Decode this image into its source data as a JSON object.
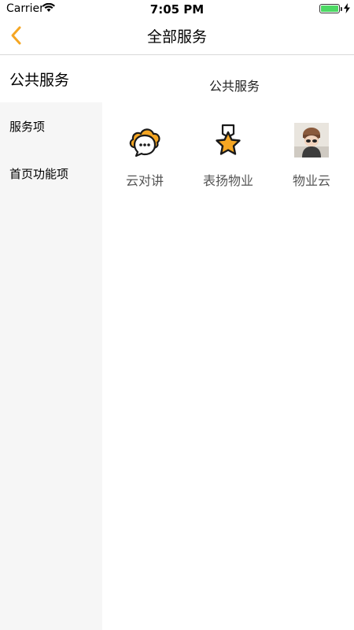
{
  "status_bar": {
    "carrier": "Carrier",
    "time": "7:05 PM",
    "wifi_icon": "wifi-icon",
    "battery_icon": "battery-icon",
    "charging_icon": "lightning-bolt-icon"
  },
  "nav": {
    "title": "全部服务",
    "back_icon": "chevron-left-icon"
  },
  "sidebar": {
    "items": [
      {
        "label": "公共服务",
        "active": true
      },
      {
        "label": "服务项",
        "active": false
      },
      {
        "label": "首页功能项",
        "active": false
      }
    ]
  },
  "main": {
    "section_title": "公共服务",
    "services": [
      {
        "label": "云对讲",
        "icon": "cloud-chat-icon"
      },
      {
        "label": "表扬物业",
        "icon": "star-medal-icon"
      },
      {
        "label": "物业云",
        "icon": "photo-thumbnail-icon"
      }
    ]
  },
  "colors": {
    "accent": "#f5a623",
    "sidebar_bg": "#f6f6f6",
    "battery": "#4cd964"
  }
}
